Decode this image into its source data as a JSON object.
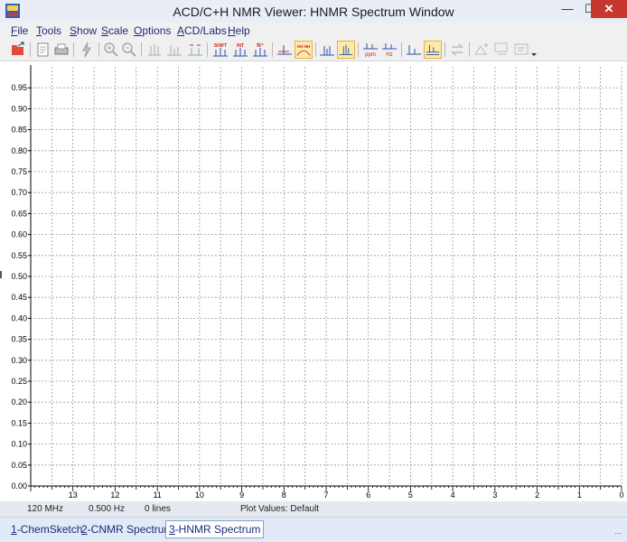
{
  "window": {
    "title": "ACD/C+H NMR Viewer: HNMR Spectrum Window",
    "min_glyph": "—",
    "max_glyph": "☐",
    "close_glyph": "✕"
  },
  "menu": [
    {
      "key": "F",
      "rest": "ile"
    },
    {
      "key": "T",
      "rest": "ools"
    },
    {
      "key": "S",
      "rest": "how"
    },
    {
      "key": "S",
      "rest": "cale"
    },
    {
      "key": "O",
      "rest": "ptions"
    },
    {
      "key": "A",
      "rest": "CD/Labs"
    },
    {
      "key": "H",
      "rest": "elp"
    }
  ],
  "toolbar": {
    "icons": [
      "open-icon",
      "print-preview-icon",
      "print-icon",
      "lightning-icon",
      "zoom-in-icon",
      "zoom-out-icon",
      "spectrum-cursor-icon",
      "spectrum-expand-icon",
      "spectrum-fit-icon",
      "shift-icon",
      "integral-icon",
      "n-plus-icon",
      "peak-pick-icon",
      "oh-nh-icon",
      "multiplet-icon",
      "multiplet-active-icon",
      "ppm-icon",
      "hz-icon",
      "baseline-icon",
      "baseline-active-icon",
      "exchange-icon",
      "assign-icon",
      "export-icon",
      "more-icon"
    ],
    "labels": {
      "shift": "SHIFT",
      "int": "INT",
      "nplus": "N⁺",
      "ohnh": "OH NH",
      "ppm": "ppm",
      "hz": "Hz"
    }
  },
  "chart_data": {
    "type": "line",
    "title": "",
    "xlabel": "",
    "ylabel": "",
    "x_ticks": [
      "13",
      "12",
      "11",
      "10",
      "9",
      "8",
      "7",
      "6",
      "5",
      "4",
      "3",
      "2",
      "1",
      "0"
    ],
    "y_ticks": [
      "0.00",
      "0.05",
      "0.10",
      "0.15",
      "0.20",
      "0.25",
      "0.30",
      "0.35",
      "0.40",
      "0.45",
      "0.50",
      "0.55",
      "0.60",
      "0.65",
      "0.70",
      "0.75",
      "0.80",
      "0.85",
      "0.90",
      "0.95"
    ],
    "xlim": [
      14,
      0
    ],
    "ylim": [
      0,
      1
    ],
    "grid": true,
    "series": []
  },
  "status": {
    "frequency": "120 MHz",
    "resolution": "0.500 Hz",
    "lines": "0 lines",
    "plot_values": "Plot Values: Default"
  },
  "tabs": [
    {
      "num": "1",
      "rest": "-ChemSketch",
      "active": false
    },
    {
      "num": "2",
      "rest": "-CNMR Spectrum",
      "active": false
    },
    {
      "num": "3",
      "rest": "-HNMR Spectrum",
      "active": true
    }
  ],
  "grip": "..."
}
